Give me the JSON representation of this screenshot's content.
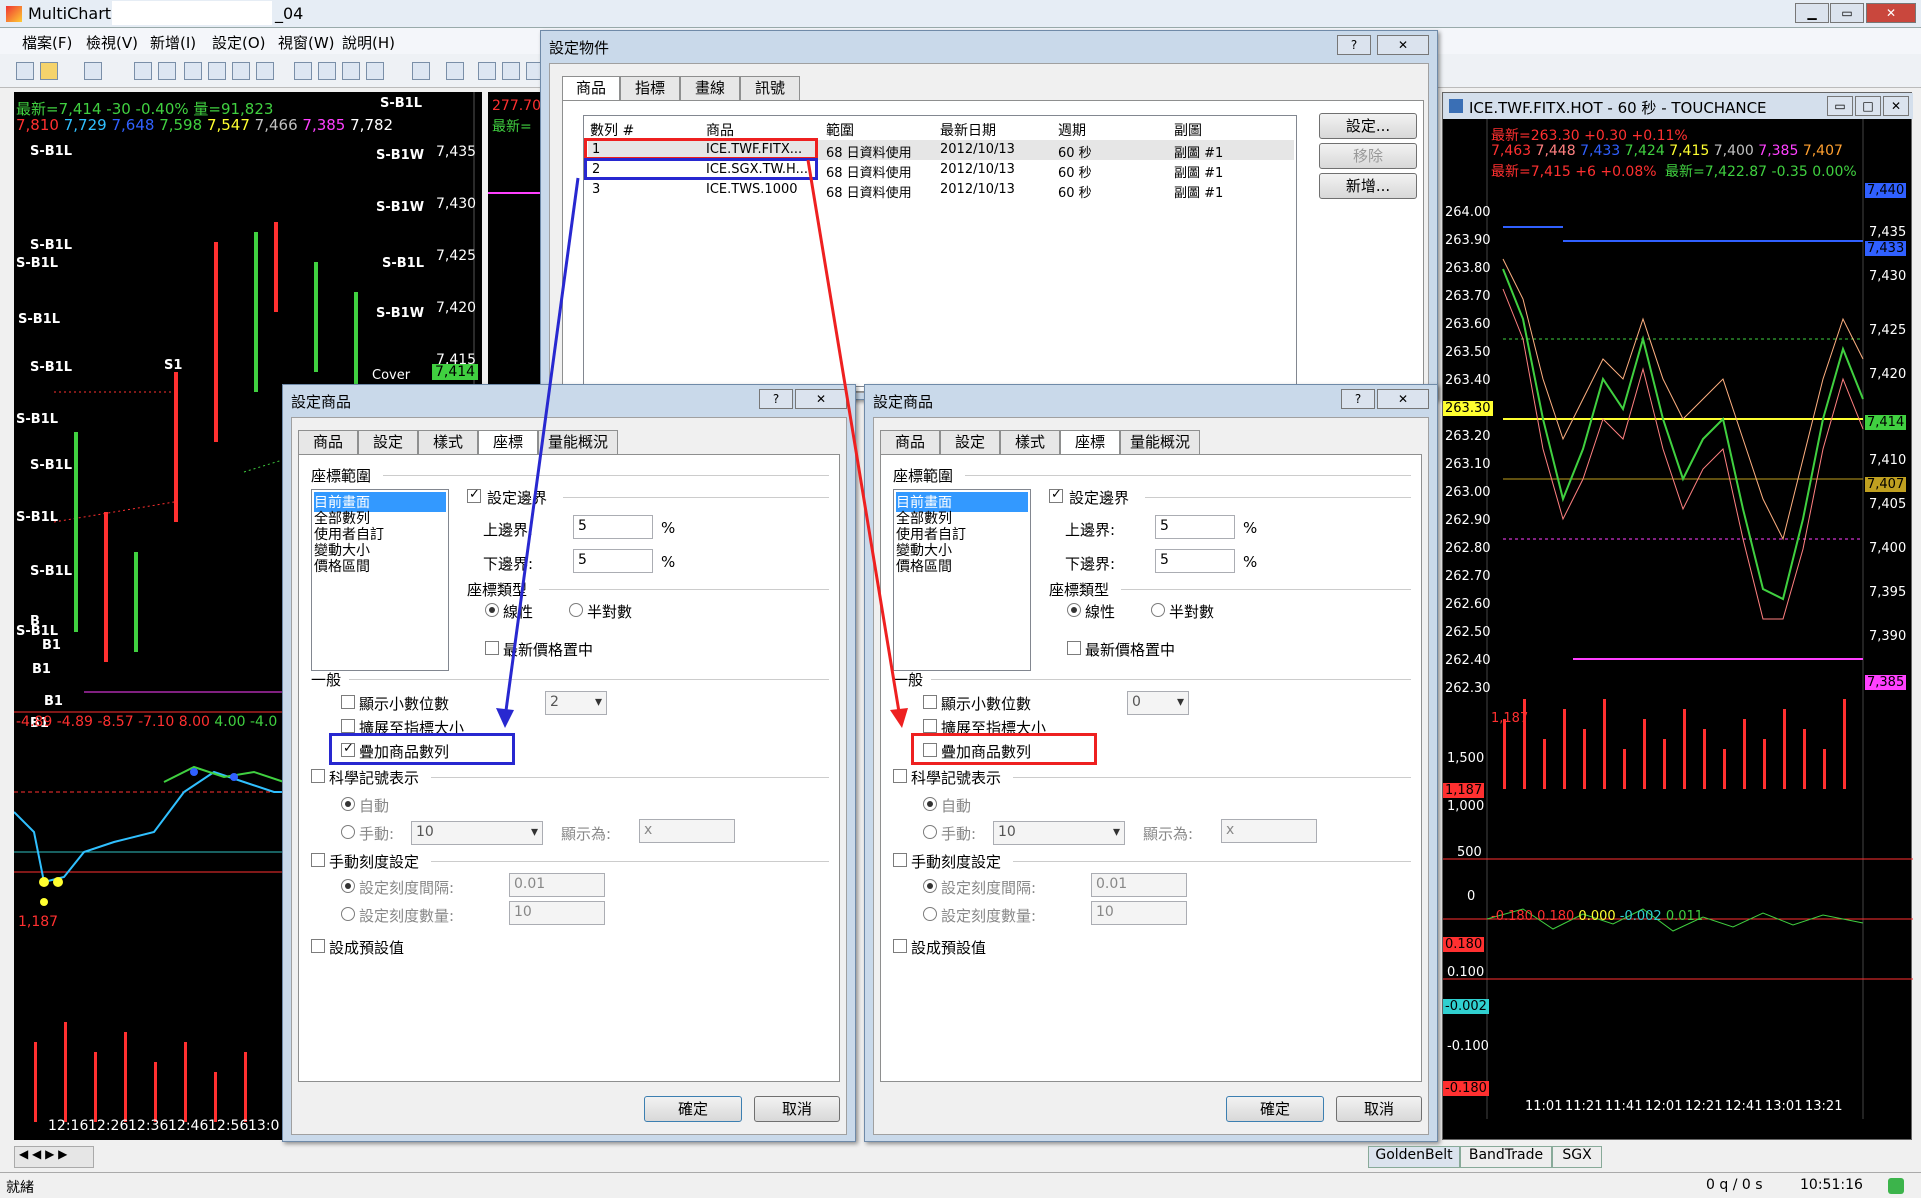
{
  "app": {
    "title": "MultiCharts",
    "title_suffix": "_04"
  },
  "menu": [
    "檔案(F)",
    "檢視(V)",
    "新增(I)",
    "設定(O)",
    "視窗(W)",
    "說明(H)"
  ],
  "left_chart": {
    "legend1": "最新=7,414  -30  -0.40%  量=91,823",
    "legend2": [
      "7,810",
      "7,729",
      "7,648",
      "7,598",
      "7,547",
      "7,466",
      "7,385",
      "7,782"
    ],
    "legend2_colors": [
      "#ff3030",
      "#30c0ff",
      "#3060ff",
      "#40d040",
      "#ffff30",
      "#c0c0c0",
      "#ff40ff",
      "#ffffff"
    ],
    "price_labels": [
      "7,435",
      "7,430",
      "7,425",
      "7,420",
      "7,415"
    ],
    "last_price": "7,414",
    "signals": [
      "S-B1L",
      "S-B1L",
      "S-B1W",
      "S-B1L",
      "S-B1W",
      "S-B1L",
      "S-B1L",
      "S-B1W",
      "S-B1L",
      "S-B1L",
      "S-B1L",
      "S-B1L",
      "S-B1L",
      "S-B1L",
      "S-B1L"
    ],
    "cover": "Cover",
    "b_labels": [
      "S1",
      "B",
      "B1",
      "B1",
      "B1",
      "B1"
    ],
    "indicator_values": [
      "-4.89",
      "-4.89",
      "-8.57",
      "-7.10",
      "8.00",
      "4.00",
      "-4.0"
    ],
    "indicator_colors": [
      "#ff3030",
      "#ff3030",
      "#ff3030",
      "#ff3030",
      "#ff3030",
      "#40d040",
      "#40d040"
    ],
    "volume_label": "1,187",
    "times": [
      "12:16",
      "12:26",
      "12:36",
      "12:46",
      "12:56",
      "13:0"
    ]
  },
  "mid_chart": {
    "v1": "277.70",
    "v2": "最新="
  },
  "right_chart": {
    "title": "ICE.TWF.FITX.HOT - 60 秒 - TOUCHANCE",
    "legend1": "最新=263.30  +0.30  +0.11%",
    "legend2": [
      "7,463",
      "7,448",
      "7,433",
      "7,424",
      "7,415",
      "7,400",
      "7,385",
      "7,407"
    ],
    "legend2_colors": [
      "#ff3030",
      "#ff8080",
      "#3060ff",
      "#40d040",
      "#ffff30",
      "#c0c0c0",
      "#ff40ff",
      "#ffa030"
    ],
    "legend3a": "最新=7,415  +6  +0.08%",
    "legend3b": "最新=7,422.87  -0.35  0.00%",
    "left_axis": [
      "264.00",
      "263.90",
      "263.80",
      "263.70",
      "263.60",
      "263.50",
      "263.40",
      "263.30",
      "263.20",
      "263.10",
      "263.00",
      "262.90",
      "262.80",
      "262.70",
      "262.60",
      "262.50",
      "262.40",
      "262.30"
    ],
    "right_axis": [
      "7,435",
      "7,430",
      "7,425",
      "7,420",
      "7,415",
      "7,410",
      "7,405",
      "7,400",
      "7,395",
      "7,390"
    ],
    "tag_left": "263.30",
    "tag_right_1": "7,414",
    "tag_right_2": "7,407",
    "tag_right_3": "7,385",
    "tag_right_top1": "7,440",
    "tag_right_top2": "7,433",
    "vol_label": "1,187",
    "vol_axis": [
      "1,500",
      "1,000",
      "500",
      "0"
    ],
    "vol_tag": "1,187",
    "osc_values": [
      "-0.180",
      "0.180",
      "0.000",
      "-0.002",
      "0.011"
    ],
    "osc_colors": [
      "#ff3030",
      "#ff3030",
      "#ffff30",
      "#30d0d0",
      "#40d040"
    ],
    "osc_axis": [
      "0.100",
      "-0.100"
    ],
    "osc_tag_top": "0.180",
    "osc_tag_mid": "-0.002",
    "osc_tag_bot": "-0.180",
    "times": [
      "11:01",
      "11:21",
      "11:41",
      "12:01",
      "12:21",
      "12:41",
      "13:01",
      "13:21"
    ]
  },
  "settings_dialog": {
    "title": "設定物件",
    "tabs": [
      "商品",
      "指標",
      "畫線",
      "訊號"
    ],
    "headers": [
      "數列 #",
      "商品",
      "範圍",
      "最新日期",
      "週期",
      "副圖"
    ],
    "rows": [
      [
        "1",
        "ICE.TWF.FITX...",
        "68 日資料使用",
        "2012/10/13",
        "60 秒",
        "副圖 #1"
      ],
      [
        "2",
        "ICE.SGX.TW.H...",
        "68 日資料使用",
        "2012/10/13",
        "60 秒",
        "副圖 #1"
      ],
      [
        "3",
        "ICE.TWS.1000",
        "68 日資料使用",
        "2012/10/13",
        "60 秒",
        "副圖 #1"
      ]
    ],
    "btn_settings": "設定...",
    "btn_remove": "移除",
    "btn_new": "新增..."
  },
  "symbol_dialog_left": {
    "title": "設定商品",
    "tabs": [
      "商品",
      "設定",
      "樣式",
      "座標",
      "量能概況"
    ],
    "range_group": "座標範圍",
    "range_items": [
      "目前畫面",
      "全部數列",
      "使用者自訂",
      "變動大小",
      "價格區間"
    ],
    "set_margin": "設定邊界",
    "upper": "上邊界:",
    "upper_val": "5",
    "lower": "下邊界:",
    "lower_val": "5",
    "pct": "%",
    "scale_type": "座標類型",
    "linear": "線性",
    "semilog": "半對數",
    "center": "最新價格置中",
    "general": "一般",
    "show_decimals": "顯示小數位數",
    "decimals_val": "2",
    "expand": "擴展至指標大小",
    "overlay": "疊加商品數列",
    "sci": "科學記號表示",
    "auto": "自動",
    "manual": "手動:",
    "manual_val": "10",
    "display_as": "顯示為:",
    "display_val": "x",
    "manual_tick": "手動刻度設定",
    "tick_interval": "設定刻度間隔:",
    "tick_interval_val": "0.01",
    "tick_count": "設定刻度數量:",
    "tick_count_val": "10",
    "default": "設成預設值",
    "ok": "確定",
    "cancel": "取消"
  },
  "symbol_dialog_right": {
    "title": "設定商品",
    "tabs": [
      "商品",
      "設定",
      "樣式",
      "座標",
      "量能概況"
    ],
    "range_group": "座標範圍",
    "range_items": [
      "目前畫面",
      "全部數列",
      "使用者自訂",
      "變動大小",
      "價格區間"
    ],
    "set_margin": "設定邊界",
    "upper": "上邊界:",
    "upper_val": "5",
    "lower": "下邊界:",
    "lower_val": "5",
    "pct": "%",
    "scale_type": "座標類型",
    "linear": "線性",
    "semilog": "半對數",
    "center": "最新價格置中",
    "general": "一般",
    "show_decimals": "顯示小數位數",
    "decimals_val": "0",
    "expand": "擴展至指標大小",
    "overlay": "疊加商品數列",
    "sci": "科學記號表示",
    "auto": "自動",
    "manual": "手動:",
    "manual_val": "10",
    "display_as": "顯示為:",
    "display_val": "x",
    "manual_tick": "手動刻度設定",
    "tick_interval": "設定刻度間隔:",
    "tick_interval_val": "0.01",
    "tick_count": "設定刻度數量:",
    "tick_count_val": "10",
    "default": "設成預設值",
    "ok": "確定",
    "cancel": "取消"
  },
  "bottom_tabs": [
    "GoldenBelt",
    "BandTrade",
    "SGX"
  ],
  "status": {
    "left": "就緒",
    "mid": "0 q / 0 s",
    "time": "10:51:16"
  }
}
